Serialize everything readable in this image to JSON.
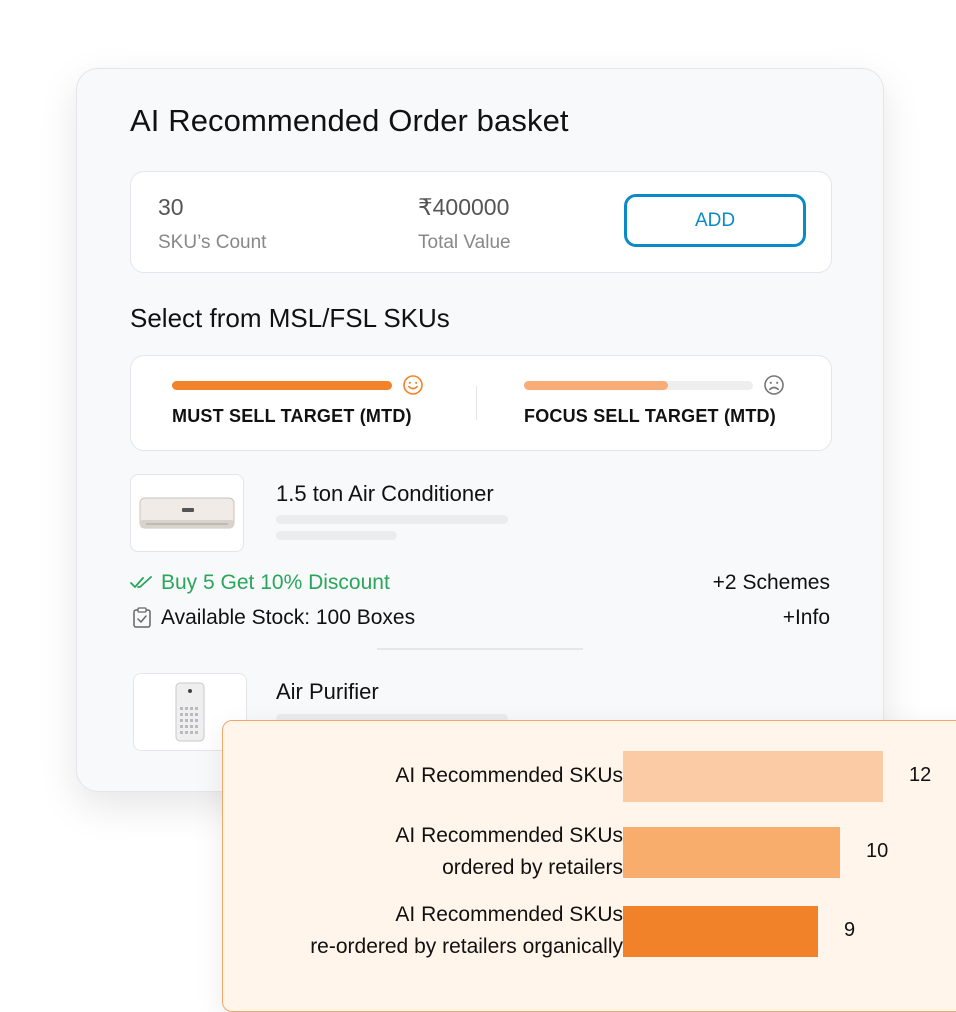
{
  "card": {
    "title": "AI Recommended Order basket",
    "basket": {
      "sku_count_value": "30",
      "sku_count_label": "SKU’s Count",
      "total_value": "₹400000",
      "total_value_label": "Total Value",
      "add_label": "ADD"
    },
    "section_title": "Select from MSL/FSL SKUs",
    "targets": {
      "must_sell": {
        "label": "MUST SELL TARGET (MTD)",
        "progress": 1.0,
        "mood": "happy",
        "color": "#f2832a"
      },
      "focus_sell": {
        "label": "FOCUS SELL TARGET (MTD)",
        "progress": 0.63,
        "mood": "sad",
        "color": "#f8ad78"
      }
    },
    "products": [
      {
        "name": "1.5 ton Air Conditioner",
        "icon": "air-conditioner-icon",
        "scheme": "Buy 5 Get 10% Discount",
        "stock": "Available Stock: 100 Boxes",
        "more_schemes": "+2 Schemes",
        "more_info": "+Info"
      },
      {
        "name": "Air Purifier",
        "icon": "air-purifier-icon"
      }
    ]
  },
  "popup": {
    "chart_data": {
      "type": "bar",
      "orientation": "horizontal",
      "categories": [
        [
          "AI Recommended SKUs"
        ],
        [
          "AI Recommended SKUs",
          "ordered by retailers"
        ],
        [
          "AI Recommended SKUs",
          "re-ordered by retailers organically"
        ]
      ],
      "values": [
        12,
        10,
        9
      ],
      "colors": [
        "#fbcba5",
        "#f8ad6d",
        "#f2822a"
      ],
      "xlim": [
        0,
        12
      ],
      "grid": false,
      "legend": "none"
    }
  },
  "colors": {
    "accent_blue": "#0b8ac9",
    "accent_orange": "#f2832a",
    "success_green": "#2aa65a"
  }
}
